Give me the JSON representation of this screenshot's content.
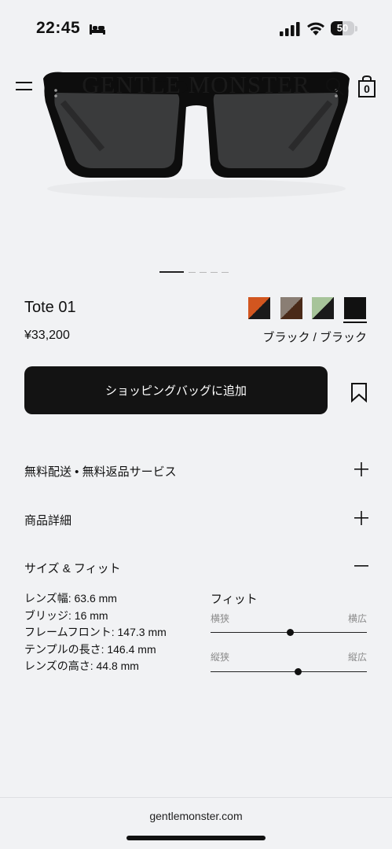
{
  "status_bar": {
    "time": "22:45",
    "battery_level": "50",
    "battery_fraction": 0.5
  },
  "header": {
    "brand": "GENTLE MONSTER",
    "bag_count": "0"
  },
  "carousel": {
    "total_images": 5,
    "active_index": 0
  },
  "product": {
    "name": "Tote 01",
    "price": "¥33,200",
    "selected_color_label": "ブラック / ブラック",
    "swatches": [
      {
        "name": "swatch-orange-black",
        "color_a": "#d2561f",
        "color_b": "#1a1a1a",
        "selected": false
      },
      {
        "name": "swatch-brown-black",
        "color_a": "#8a7e74",
        "color_b": "#4a2a18",
        "selected": false
      },
      {
        "name": "swatch-green-black",
        "color_a": "#a7c49a",
        "color_b": "#1a1a1a",
        "selected": false
      },
      {
        "name": "swatch-black",
        "color_a": "#111111",
        "color_b": "#111111",
        "selected": true
      }
    ]
  },
  "actions": {
    "add_to_bag_label": "ショッピングバッグに追加"
  },
  "accordion": [
    {
      "label": "無料配送 • 無料返品サービス",
      "icon": "plus-icon",
      "expanded": false
    },
    {
      "label": "商品詳細",
      "icon": "plus-icon",
      "expanded": false
    },
    {
      "label": "サイズ & フィット",
      "icon": "minus-icon",
      "expanded": true
    }
  ],
  "size_fit": {
    "specs": [
      "レンズ幅: 63.6 mm",
      "ブリッジ: 16 mm",
      "フレームフロント: 147.3 mm",
      "テンプルの長さ: 146.4 mm",
      "レンズの高さ: 44.8 mm"
    ],
    "fit_title": "フィット",
    "sliders": [
      {
        "left_label": "横狭",
        "right_label": "横広",
        "value": 0.51
      },
      {
        "left_label": "縦狭",
        "right_label": "縦広",
        "value": 0.56
      }
    ]
  },
  "footer": {
    "url": "gentlemonster.com"
  },
  "colors": {
    "background": "#f1f2f4",
    "button": "#131313",
    "text": "#111111"
  }
}
